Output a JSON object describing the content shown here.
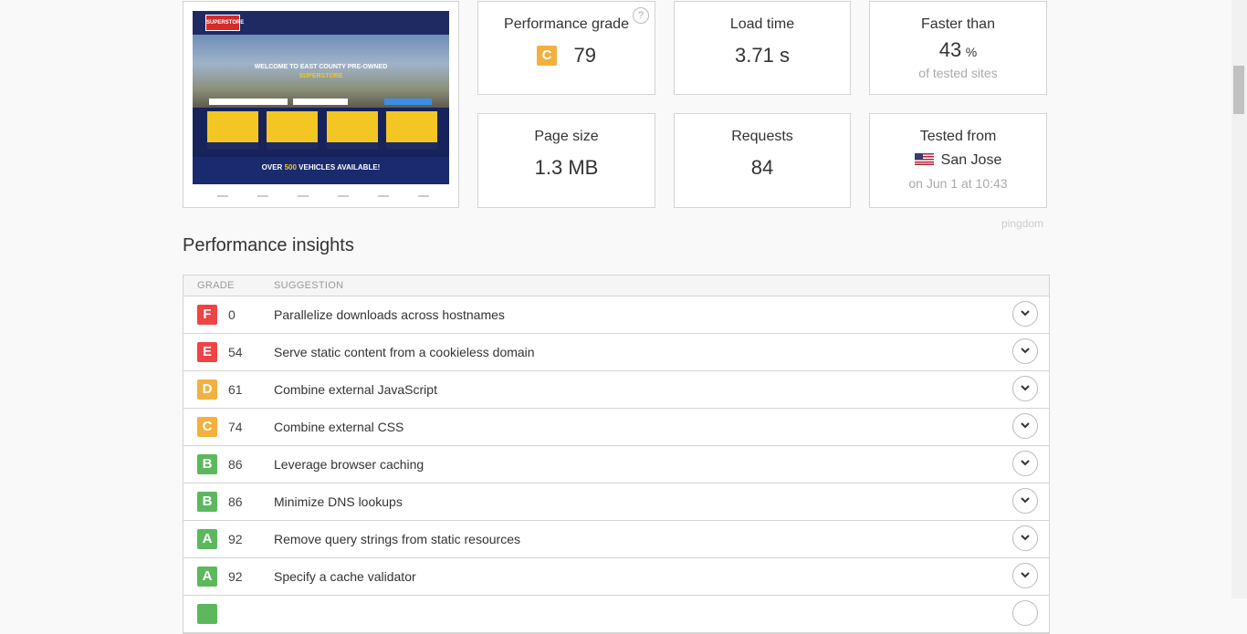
{
  "thumbnail": {
    "hero_line1": "WELCOME TO EAST COUNTY PRE-OWNED",
    "hero_line2": "SUPERSTORE",
    "band_prefix": "OVER ",
    "band_num": "500",
    "band_suffix": " VEHICLES AVAILABLE!",
    "logo": "SUPERSTORE"
  },
  "summary": {
    "performance": {
      "title": "Performance grade",
      "grade": "C",
      "score": "79",
      "grade_color": "#f4b03e"
    },
    "load_time": {
      "title": "Load time",
      "value": "3.71 s"
    },
    "faster_than": {
      "title": "Faster than",
      "value": "43",
      "unit": "%",
      "sub": "of tested sites"
    },
    "page_size": {
      "title": "Page size",
      "value": "1.3 MB"
    },
    "requests": {
      "title": "Requests",
      "value": "84"
    },
    "tested_from": {
      "title": "Tested from",
      "location": "San Jose",
      "when": "on Jun 1 at 10:43"
    },
    "brand": "pingdom"
  },
  "insights": {
    "title": "Performance insights",
    "col_grade": "GRADE",
    "col_suggestion": "SUGGESTION",
    "rows": [
      {
        "grade": "F",
        "score": "0",
        "suggestion": "Parallelize downloads across hostnames",
        "color": "#ef4444"
      },
      {
        "grade": "E",
        "score": "54",
        "suggestion": "Serve static content from a cookieless domain",
        "color": "#ef4444"
      },
      {
        "grade": "D",
        "score": "61",
        "suggestion": "Combine external JavaScript",
        "color": "#f4b03e"
      },
      {
        "grade": "C",
        "score": "74",
        "suggestion": "Combine external CSS",
        "color": "#f4b03e"
      },
      {
        "grade": "B",
        "score": "86",
        "suggestion": "Leverage browser caching",
        "color": "#5cb85c"
      },
      {
        "grade": "B",
        "score": "86",
        "suggestion": "Minimize DNS lookups",
        "color": "#5cb85c"
      },
      {
        "grade": "A",
        "score": "92",
        "suggestion": "Remove query strings from static resources",
        "color": "#5cb85c"
      },
      {
        "grade": "A",
        "score": "92",
        "suggestion": "Specify a cache validator",
        "color": "#5cb85c"
      }
    ]
  }
}
